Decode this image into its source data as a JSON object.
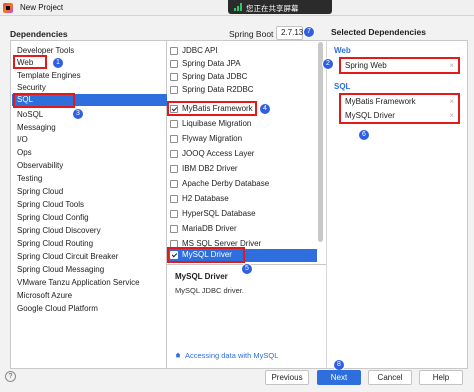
{
  "window": {
    "title": "New Project",
    "icon": "intellij-icon"
  },
  "share_bar": {
    "label": "您正在共享屏幕",
    "icon": "signal-bars-icon",
    "color": "#36c36b"
  },
  "dependencies_label": "Dependencies",
  "spring_boot": {
    "label": "Spring Boot",
    "version": "2.7.13"
  },
  "categories": [
    "Developer Tools",
    "Web",
    "Template Engines",
    "Security",
    "SQL",
    "NoSQL",
    "Messaging",
    "I/O",
    "Ops",
    "Observability",
    "Testing",
    "Spring Cloud",
    "Spring Cloud Tools",
    "Spring Cloud Config",
    "Spring Cloud Discovery",
    "Spring Cloud Routing",
    "Spring Cloud Circuit Breaker",
    "Spring Cloud Messaging",
    "VMware Tanzu Application Service",
    "Microsoft Azure",
    "Google Cloud Platform"
  ],
  "selected_category": "SQL",
  "dependency_list": [
    {
      "label": "JDBC API",
      "checked": false
    },
    {
      "label": "Spring Data JPA",
      "checked": false
    },
    {
      "label": "Spring Data JDBC",
      "checked": false
    },
    {
      "label": "Spring Data R2DBC",
      "checked": false
    },
    {
      "label": "MyBatis Framework",
      "checked": true
    },
    {
      "label": "Liquibase Migration",
      "checked": false
    },
    {
      "label": "Flyway Migration",
      "checked": false
    },
    {
      "label": "JOOQ Access Layer",
      "checked": false
    },
    {
      "label": "IBM DB2 Driver",
      "checked": false
    },
    {
      "label": "Apache Derby Database",
      "checked": false
    },
    {
      "label": "H2 Database",
      "checked": false
    },
    {
      "label": "HyperSQL Database",
      "checked": false
    },
    {
      "label": "MariaDB Driver",
      "checked": false
    },
    {
      "label": "MS SQL Server Driver",
      "checked": false
    },
    {
      "label": "MySQL Driver",
      "checked": true
    }
  ],
  "description": {
    "title": "MySQL Driver",
    "text": "MySQL JDBC driver.",
    "link": "Accessing data with MySQL"
  },
  "selected_dependencies": {
    "title": "Selected Dependencies",
    "groups": [
      {
        "name": "Web",
        "items": [
          "Spring Web"
        ]
      },
      {
        "name": "SQL",
        "items": [
          "MyBatis Framework",
          "MySQL Driver"
        ]
      }
    ],
    "remove_glyph": "×"
  },
  "annotations": [
    "1",
    "2",
    "3",
    "4",
    "5",
    "6",
    "7",
    "8"
  ],
  "buttons": {
    "help": "?",
    "previous": "Previous",
    "next": "Next",
    "cancel": "Cancel",
    "help_label": "Help"
  },
  "colors": {
    "accent": "#2e6fdd",
    "highlight": "#e31a1a",
    "badge": "#2f5fe2"
  }
}
